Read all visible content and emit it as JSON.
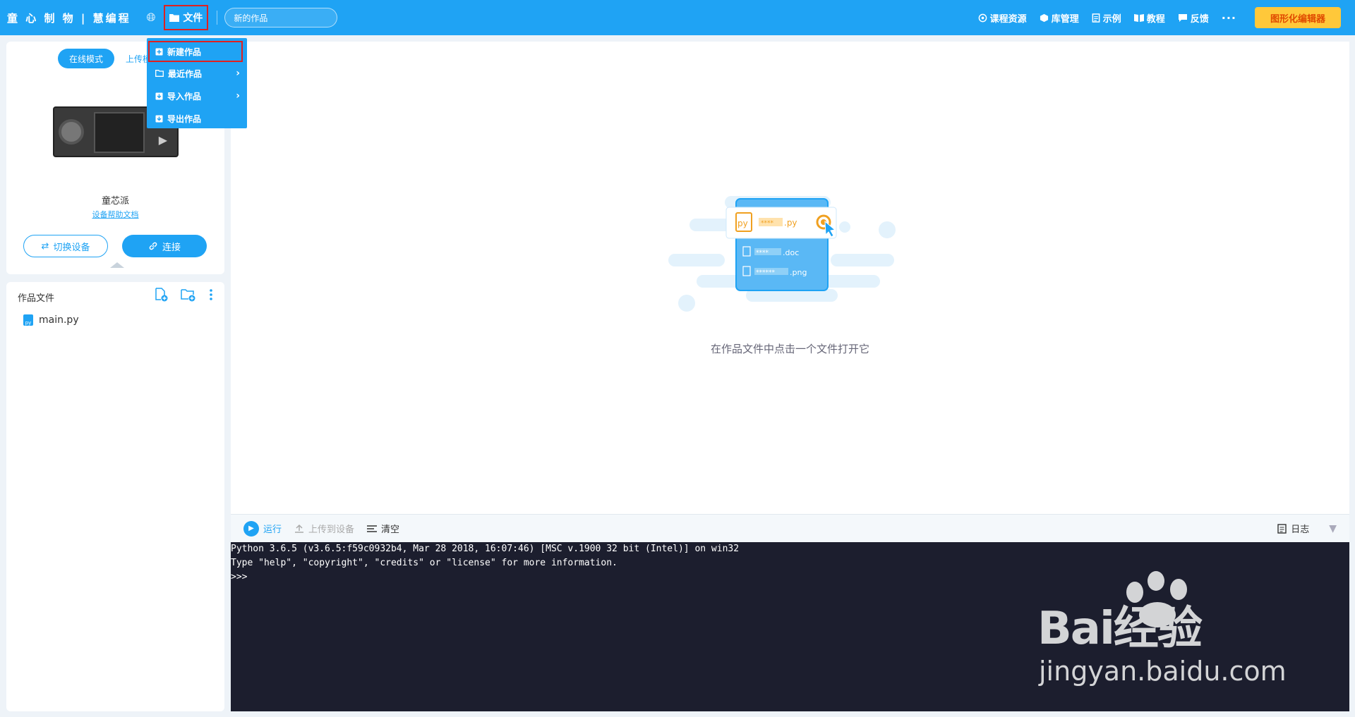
{
  "header": {
    "brand": "童 心 制 物 | 慧编程",
    "file_label": "文件",
    "project_name": "新的作品",
    "nav": [
      {
        "label": "课程资源",
        "icon": "eye-icon"
      },
      {
        "label": "库管理",
        "icon": "cube-icon"
      },
      {
        "label": "示例",
        "icon": "doc-icon"
      },
      {
        "label": "教程",
        "icon": "book-icon"
      },
      {
        "label": "反馈",
        "icon": "chat-icon"
      }
    ],
    "more": "···",
    "graphic_editor": "图形化编辑器"
  },
  "file_menu": {
    "items": [
      {
        "label": "新建作品"
      },
      {
        "label": "最近作品"
      },
      {
        "label": "导入作品"
      },
      {
        "label": "导出作品"
      }
    ]
  },
  "device_panel": {
    "tabs": [
      "在线模式",
      "上传模式"
    ],
    "device_name": "童芯派",
    "help_link": "设备帮助文档",
    "switch_label": "切换设备",
    "connect_label": "连接"
  },
  "files_panel": {
    "title": "作品文件",
    "files": [
      {
        "name": "main.py"
      }
    ]
  },
  "main": {
    "empty_hint": "在作品文件中点击一个文件打开它",
    "illustration": {
      "py_label": ".py",
      "doc_label": ".doc",
      "png_label": ".png",
      "py_tag": "py",
      "mask_py": "****",
      "mask_doc": "****",
      "mask_png": "******"
    }
  },
  "console_bar": {
    "run": "运行",
    "upload": "上传到设备",
    "clear": "清空",
    "log": "日志"
  },
  "console": {
    "lines": [
      "Python 3.6.5 (v3.6.5:f59c0932b4, Mar 28 2018, 16:07:46) [MSC v.1900 32 bit (Intel)] on win32",
      "Type \"help\", \"copyright\", \"credits\" or \"license\" for more information.",
      ">>>"
    ]
  },
  "watermark": {
    "main": "Bai经验",
    "sub": "jingyan.baidu.com"
  },
  "colors": {
    "primary": "#1fa3f4",
    "accent_yellow": "#ffc83a",
    "console_bg": "#1c1e2e",
    "highlight_red": "#e02020"
  }
}
